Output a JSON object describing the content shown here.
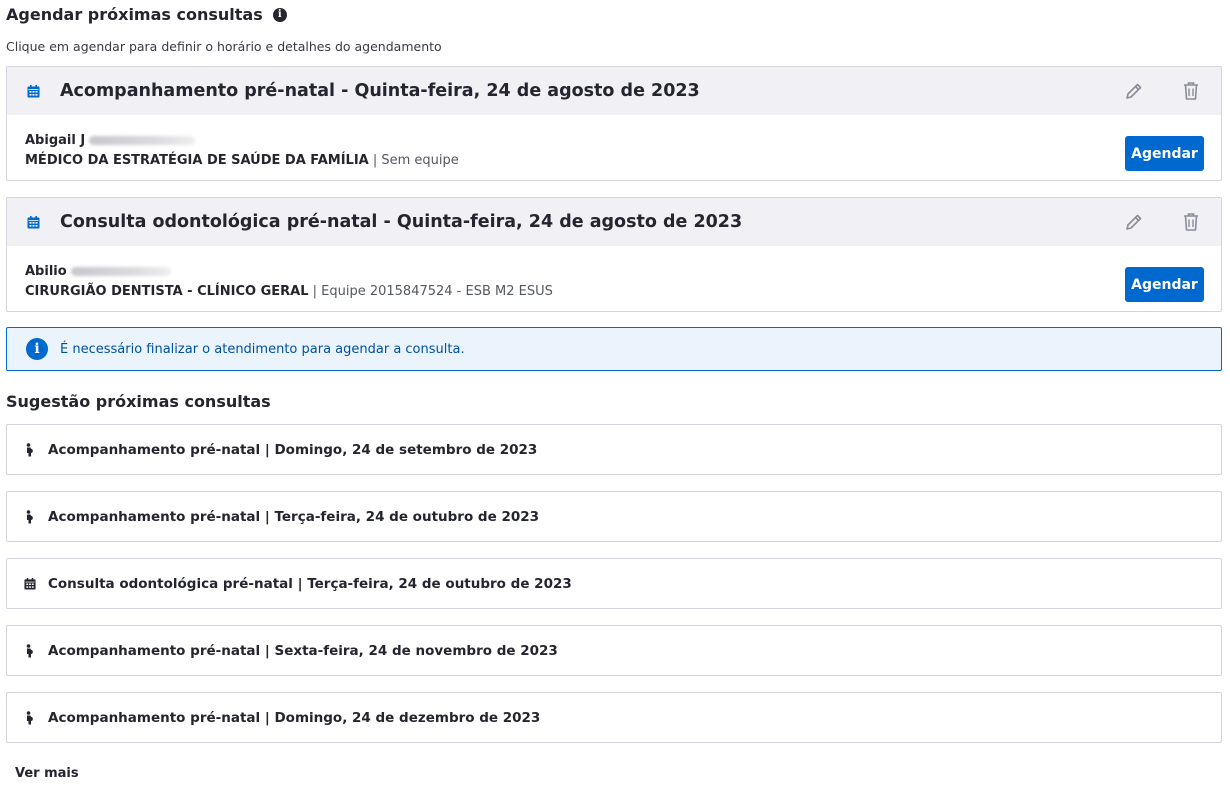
{
  "agendar": {
    "title": "Agendar próximas consultas",
    "info_glyph": "i",
    "subtitle": "Clique em agendar para definir o horário e detalhes do agendamento",
    "cards": [
      {
        "title": "Acompanhamento pré-natal - Quinta-feira, 24 de agosto de 2023",
        "professional_name": "Abigail J",
        "role": "MÉDICO DA ESTRATÉGIA DE SAÚDE DA FAMÍLIA",
        "team": " | Sem equipe",
        "button_label": "Agendar"
      },
      {
        "title": "Consulta odontológica pré-natal - Quinta-feira, 24 de agosto de 2023",
        "professional_name": "Abilio",
        "role": "CIRURGIÃO DENTISTA - CLÍNICO GERAL",
        "team": " | Equipe 2015847524 - ESB M2 ESUS",
        "button_label": "Agendar"
      }
    ]
  },
  "alert": {
    "icon_glyph": "i",
    "text": "É necessário finalizar o atendimento para agendar a consulta."
  },
  "sugestao": {
    "title": "Sugestão próximas consultas",
    "items": [
      {
        "text": "Acompanhamento pré-natal | Domingo, 24 de setembro de 2023",
        "icon": "pregnant-icon"
      },
      {
        "text": "Acompanhamento pré-natal | Terça-feira, 24 de outubro de 2023",
        "icon": "pregnant-icon"
      },
      {
        "text": "Consulta odontológica pré-natal | Terça-feira, 24 de outubro de 2023",
        "icon": "calendar-icon"
      },
      {
        "text": "Acompanhamento pré-natal | Sexta-feira, 24 de novembro de 2023",
        "icon": "pregnant-icon"
      },
      {
        "text": "Acompanhamento pré-natal | Domingo, 24 de dezembro de 2023",
        "icon": "pregnant-icon"
      }
    ]
  },
  "ver_mais": "Ver mais",
  "colors": {
    "primary": "#0069d0",
    "text": "#24252e",
    "muted_text": "#545764",
    "card_header_bg": "#f0f0f5",
    "border": "#d3d4dd",
    "alert_bg": "#ebf3fd"
  }
}
